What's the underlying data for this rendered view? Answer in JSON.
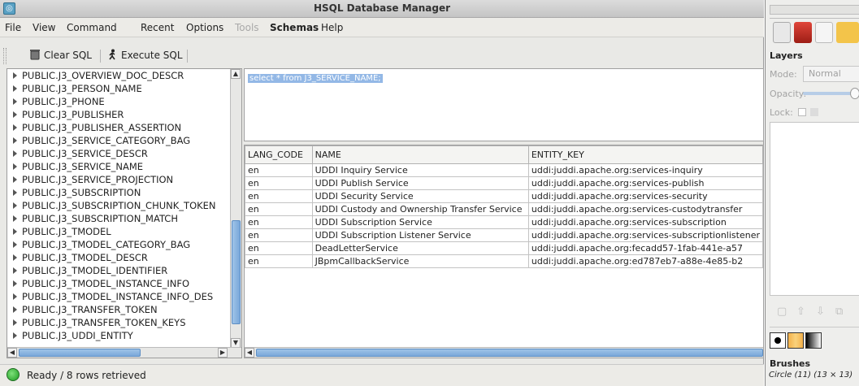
{
  "window": {
    "title": "HSQL Database Manager"
  },
  "menu": {
    "file": "File",
    "view": "View",
    "command": "Command",
    "recent": "Recent",
    "options": "Options",
    "tools": "Tools",
    "schemas": "Schemas",
    "help": "Help"
  },
  "toolbar": {
    "clear_sql": "Clear SQL",
    "execute_sql": "Execute SQL"
  },
  "tree": {
    "items": [
      "PUBLIC.J3_OVERVIEW_DOC_DESCR",
      "PUBLIC.J3_PERSON_NAME",
      "PUBLIC.J3_PHONE",
      "PUBLIC.J3_PUBLISHER",
      "PUBLIC.J3_PUBLISHER_ASSERTION",
      "PUBLIC.J3_SERVICE_CATEGORY_BAG",
      "PUBLIC.J3_SERVICE_DESCR",
      "PUBLIC.J3_SERVICE_NAME",
      "PUBLIC.J3_SERVICE_PROJECTION",
      "PUBLIC.J3_SUBSCRIPTION",
      "PUBLIC.J3_SUBSCRIPTION_CHUNK_TOKEN",
      "PUBLIC.J3_SUBSCRIPTION_MATCH",
      "PUBLIC.J3_TMODEL",
      "PUBLIC.J3_TMODEL_CATEGORY_BAG",
      "PUBLIC.J3_TMODEL_DESCR",
      "PUBLIC.J3_TMODEL_IDENTIFIER",
      "PUBLIC.J3_TMODEL_INSTANCE_INFO",
      "PUBLIC.J3_TMODEL_INSTANCE_INFO_DES",
      "PUBLIC.J3_TRANSFER_TOKEN",
      "PUBLIC.J3_TRANSFER_TOKEN_KEYS",
      "PUBLIC.J3_UDDI_ENTITY"
    ]
  },
  "editor": {
    "sql": "select * from J3_SERVICE_NAME;"
  },
  "results": {
    "columns": [
      "LANG_CODE",
      "NAME",
      "ENTITY_KEY"
    ],
    "rows": [
      [
        "en",
        "UDDI Inquiry Service",
        "uddi:juddi.apache.org:services-inquiry"
      ],
      [
        "en",
        "UDDI Publish Service",
        "uddi:juddi.apache.org:services-publish"
      ],
      [
        "en",
        "UDDI Security Service",
        "uddi:juddi.apache.org:services-security"
      ],
      [
        "en",
        "UDDI Custody and Ownership Transfer Service",
        "uddi:juddi.apache.org:services-custodytransfer"
      ],
      [
        "en",
        "UDDI Subscription Service",
        "uddi:juddi.apache.org:services-subscription"
      ],
      [
        "en",
        "UDDI Subscription Listener Service",
        "uddi:juddi.apache.org:services-subscriptionlistener"
      ],
      [
        "en",
        "DeadLetterService",
        "uddi:juddi.apache.org:fecadd57-1fab-441e-a57"
      ],
      [
        "en",
        "JBpmCallbackService",
        "uddi:juddi.apache.org:ed787eb7-a88e-4e85-b2"
      ]
    ]
  },
  "status": {
    "text": "Ready / 8 rows retrieved"
  },
  "gimp": {
    "layers_title": "Layers",
    "mode_label": "Mode:",
    "mode_value": "Normal",
    "opacity_label": "Opacity:",
    "lock_label": "Lock:",
    "brushes_title": "Brushes",
    "brush_value": "Circle (11) (13 × 13)"
  },
  "colors": {
    "selection": "#93b8e6",
    "scroll_thumb": "#7aa8d9",
    "status_ok": "#1c9b20"
  }
}
